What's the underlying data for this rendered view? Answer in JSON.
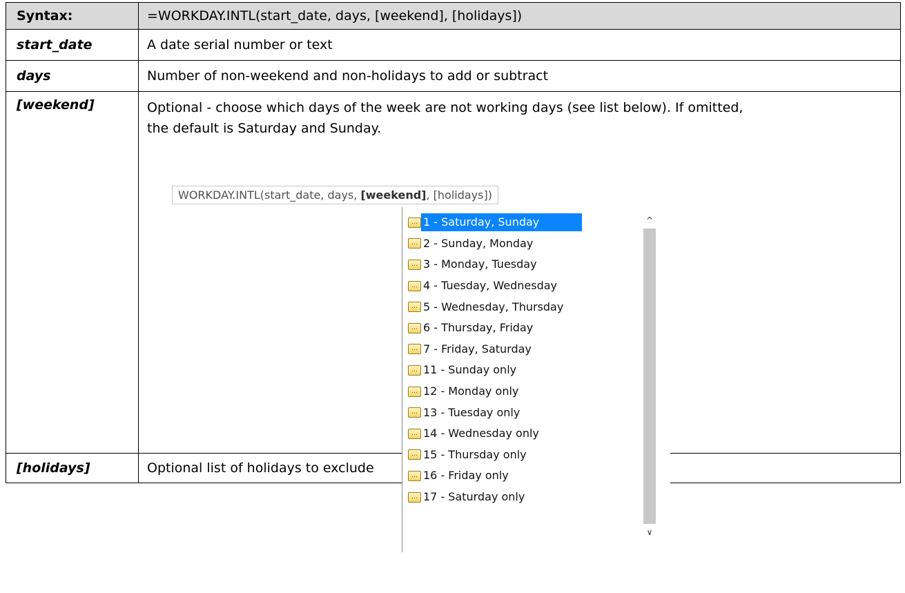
{
  "rows": {
    "syntax": {
      "key": "Syntax:",
      "value": "=WORKDAY.INTL(start_date, days, [weekend], [holidays])"
    },
    "start_date": {
      "key": "start_date",
      "value": "A date serial number or text"
    },
    "days": {
      "key": "days",
      "value": "Number of non-weekend and non-holidays to add or subtract"
    },
    "weekend": {
      "key": "[weekend]",
      "line1": "Optional - choose which days of the week are not working days (see list below). If omitted,",
      "line2": "the default is Saturday and Sunday."
    },
    "holidays": {
      "key": "[holidays]",
      "value": "Optional list of holidays to exclude"
    }
  },
  "tooltip": {
    "prefix": "WORKDAY.INTL(start_date, days, ",
    "bold": "[weekend]",
    "suffix": ", [holidays])"
  },
  "dropdown": {
    "icon": "constant-icon",
    "items": [
      "1 - Saturday, Sunday",
      "2 - Sunday, Monday",
      "3 - Monday, Tuesday",
      "4 - Tuesday, Wednesday",
      "5 - Wednesday, Thursday",
      "6 - Thursday, Friday",
      "7 - Friday, Saturday",
      "11 - Sunday only",
      "12 - Monday only",
      "13 - Tuesday only",
      "14 - Wednesday only",
      "15 - Thursday only",
      "16 - Friday only",
      "17 - Saturday only"
    ],
    "selected_index": 0
  },
  "colors": {
    "header_bg": "#d9d9d9",
    "selection": "#0a84ff",
    "scrollbar": "#c8c8c8"
  }
}
